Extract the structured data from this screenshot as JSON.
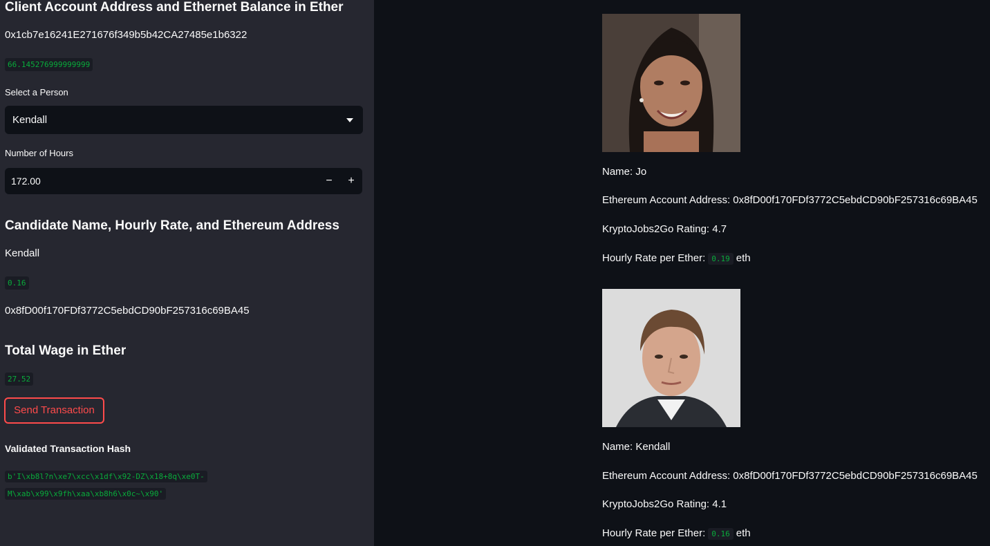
{
  "sidebar": {
    "client_heading": "Client Account Address and Ethernet Balance in Ether",
    "client_address": "0x1cb7e16241E271676f349b5b42CA27485e1b6322",
    "client_balance": "66.145276999999999",
    "select_label": "Select a Person",
    "select_value": "Kendall",
    "hours_label": "Number of Hours",
    "hours_value": "172.00",
    "decrement_symbol": "−",
    "increment_symbol": "+",
    "candidate_heading": "Candidate Name, Hourly Rate, and Ethereum Address",
    "candidate_name": "Kendall",
    "candidate_rate": "0.16",
    "candidate_address": "0x8fD00f170FDf3772C5ebdCD90bF257316c69BA45",
    "wage_heading": "Total Wage in Ether",
    "wage_value": "27.52",
    "send_button": "Send Transaction",
    "hash_heading": "Validated Transaction Hash",
    "hash_line1": "b'I\\xb8l?n\\xe7\\xcc\\x1df\\x92-DZ\\x18+8q\\xe0T-",
    "hash_line2": "M\\xab\\x99\\x9fh\\xaa\\xb8h6\\x0c~\\x90'"
  },
  "candidates": [
    {
      "name": "Name: Jo",
      "address": "Ethereum Account Address: 0x8fD00f170FDf3772C5ebdCD90bF257316c69BA45",
      "rating": "KryptoJobs2Go Rating: 4.7",
      "rate_prefix": "Hourly Rate per Ether:",
      "rate_value": "0.19",
      "rate_suffix": "eth"
    },
    {
      "name": "Name: Kendall",
      "address": "Ethereum Account Address: 0x8fD00f170FDf3772C5ebdCD90bF257316c69BA45",
      "rating": "KryptoJobs2Go Rating: 4.1",
      "rate_prefix": "Hourly Rate per Ether:",
      "rate_value": "0.16",
      "rate_suffix": "eth"
    }
  ],
  "icons": {
    "select_caret": "caret-down-icon"
  }
}
